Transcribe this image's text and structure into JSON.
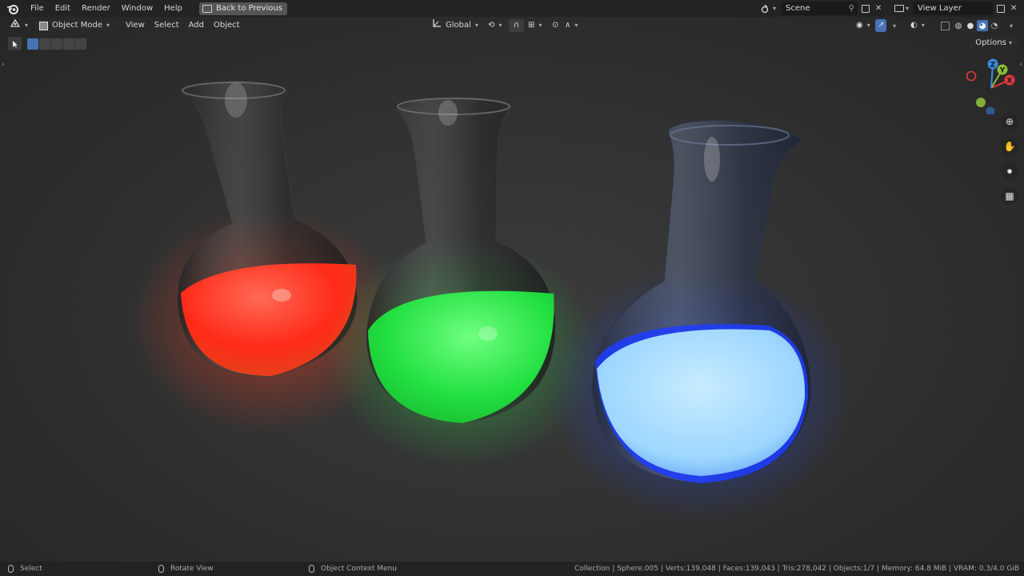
{
  "menu": {
    "items": [
      "File",
      "Edit",
      "Render",
      "Window",
      "Help"
    ],
    "back_label": "Back to Previous"
  },
  "scene": {
    "name": "Scene"
  },
  "view_layer": {
    "name": "View Layer"
  },
  "viewport_header": {
    "mode_label": "Object Mode",
    "menus": [
      "View",
      "Select",
      "Add",
      "Object"
    ],
    "transform_orientation": "Global",
    "options_label": "Options"
  },
  "gizmo": {
    "axes": [
      "X",
      "Y",
      "Z"
    ]
  },
  "scene_objects": [
    {
      "name": "red-flask",
      "liquid_color": "#ff3a20"
    },
    {
      "name": "green-flask",
      "liquid_color": "#2fe84a"
    },
    {
      "name": "blue-flask",
      "liquid_color": "#9fd8ff"
    }
  ],
  "status": {
    "left": [
      "Select",
      "Rotate View",
      "Object Context Menu"
    ],
    "stats": "Collection | Sphere.005 | Verts:139,048 | Faces:139,043 | Tris:278,042 | Objects:1/7 | Memory: 64.8 MiB | VRAM: 0.3/4.0 GiB"
  },
  "colors": {
    "accent": "#4772b3",
    "axis_x": "#e2393c",
    "axis_y": "#8bbd3a",
    "axis_z": "#3a8be2"
  }
}
